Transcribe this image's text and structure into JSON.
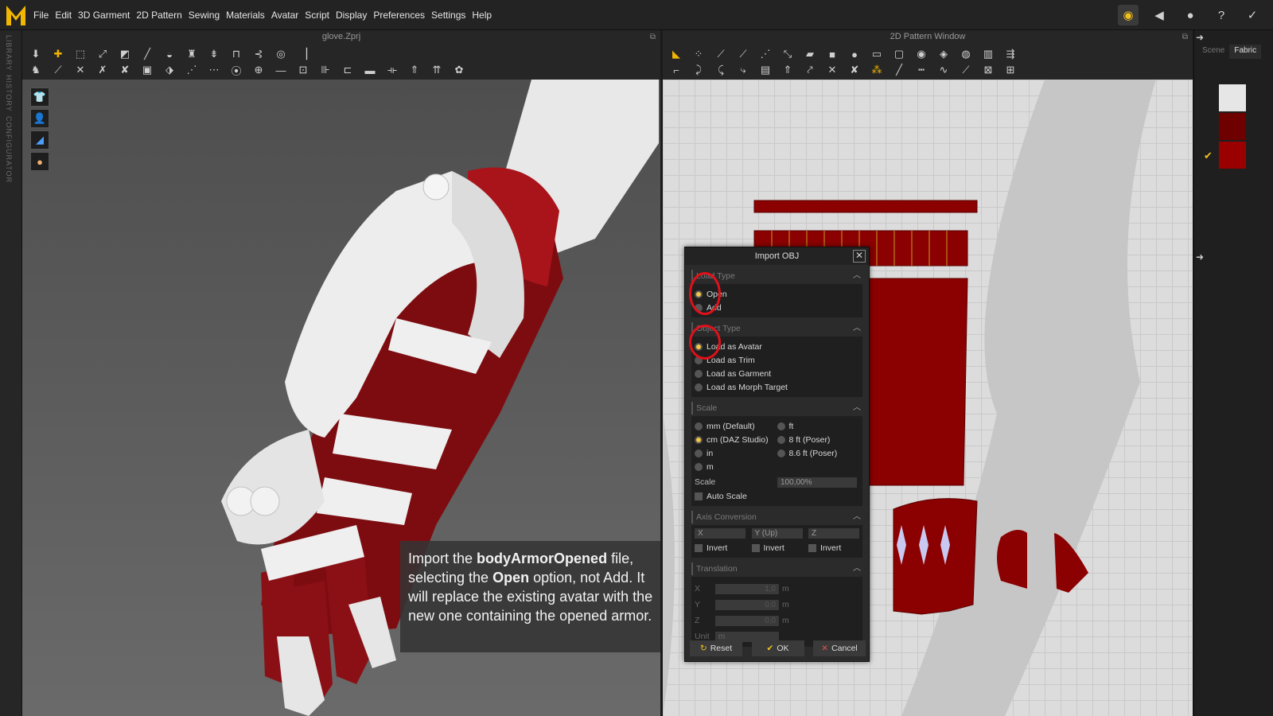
{
  "menubar": {
    "logo": "M",
    "items": [
      "File",
      "Edit",
      "3D Garment",
      "2D Pattern",
      "Sewing",
      "Materials",
      "Avatar",
      "Script",
      "Display",
      "Preferences",
      "Settings",
      "Help"
    ],
    "icons": [
      "connect-icon",
      "volume-icon",
      "user-icon",
      "help-icon",
      "bird-icon"
    ]
  },
  "left_strip": {
    "labels": [
      "LIBRARY",
      "HISTORY",
      "CONFIGURATOR"
    ]
  },
  "pane3d": {
    "title": "glove.Zprj"
  },
  "pane2d": {
    "title": "2D Pattern Window"
  },
  "right_panel": {
    "tabs": [
      "Scene",
      "Fabric"
    ],
    "swatch_colors": [
      "#e6e6e6",
      "#6e0000",
      "#9b0000"
    ]
  },
  "callout": {
    "pre1": "Import the ",
    "b1": "bodyArmorOpened",
    "post1": " file, selecting the ",
    "b2": "Open",
    "post2": " option, not Add. It will replace the existing avatar with the new one containing the opened armor."
  },
  "dialog": {
    "title": "Import OBJ",
    "load_type": {
      "header": "Load Type",
      "options": [
        "Open",
        "Add"
      ],
      "selected": "Open"
    },
    "object_type": {
      "header": "Object Type",
      "options": [
        "Load as Avatar",
        "Load as Trim",
        "Load as Garment",
        "Load as Morph Target"
      ],
      "selected": "Load as Avatar"
    },
    "scale": {
      "header": "Scale",
      "options_left": [
        "mm (Default)",
        "cm (DAZ Studio)",
        "in",
        "m"
      ],
      "options_right": [
        "ft",
        "8 ft (Poser)",
        "8.6 ft (Poser)"
      ],
      "selected": "cm (DAZ Studio)",
      "scale_label": "Scale",
      "scale_value": "100,00%",
      "auto_scale": "Auto Scale"
    },
    "axis": {
      "header": "Axis Conversion",
      "axes": [
        "X",
        "Y (Up)",
        "Z"
      ],
      "invert": "Invert"
    },
    "translation": {
      "header": "Translation",
      "rows": [
        {
          "label": "X",
          "value": "1,0",
          "unit": "m"
        },
        {
          "label": "Y",
          "value": "0,0",
          "unit": "m"
        },
        {
          "label": "Z",
          "value": "0,0",
          "unit": "m"
        }
      ],
      "unit_label": "Unit",
      "unit_value": "m"
    },
    "buttons": {
      "reset": "Reset",
      "ok": "OK",
      "cancel": "Cancel"
    }
  },
  "colors": {
    "accent": "#f2c640",
    "fabric_red": "#8b0000",
    "highlight_red": "#e0101a"
  }
}
